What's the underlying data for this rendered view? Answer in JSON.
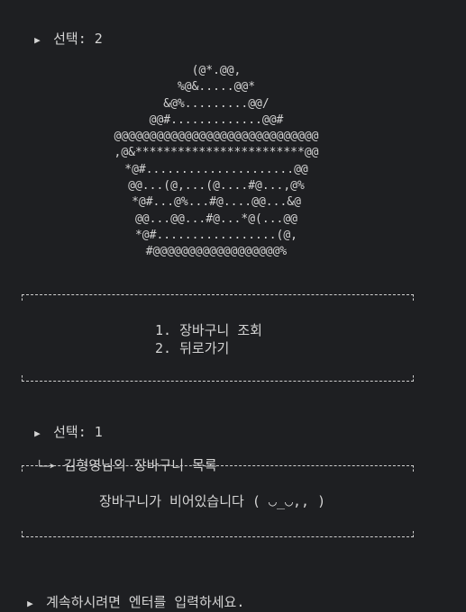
{
  "first_prompt": {
    "marker": "▶",
    "label": "선택: 2"
  },
  "ascii_art": [
    "(@*.@@,",
    "%@&.....@@*",
    "&@%.........@@/",
    "@@#.............@@#",
    "@@@@@@@@@@@@@@@@@@@@@@@@@@@@@",
    ",@&************************@@",
    "*@#.....................@@",
    "@@...(@,...(@....#@...,@%",
    "*@#...@%...#@....@@...&@",
    "@@...@@...#@...*@(...@@",
    "*@#.................(@,",
    "#@@@@@@@@@@@@@@@@@@%"
  ],
  "menu": {
    "items": [
      "1. 장바구니 조회",
      "2. 뒤로가기"
    ]
  },
  "second_prompt": {
    "marker": "▶",
    "label": "선택: 1"
  },
  "cart_header": {
    "marker": "└─➤",
    "label": "김형영님의 장바구니 목록"
  },
  "cart_empty_message": "장바구니가 비어있습니다 ( ◡_◡,, )",
  "continue_prompt": {
    "marker": "▶",
    "label": "계속하시려면 엔터를 입력하세요."
  }
}
